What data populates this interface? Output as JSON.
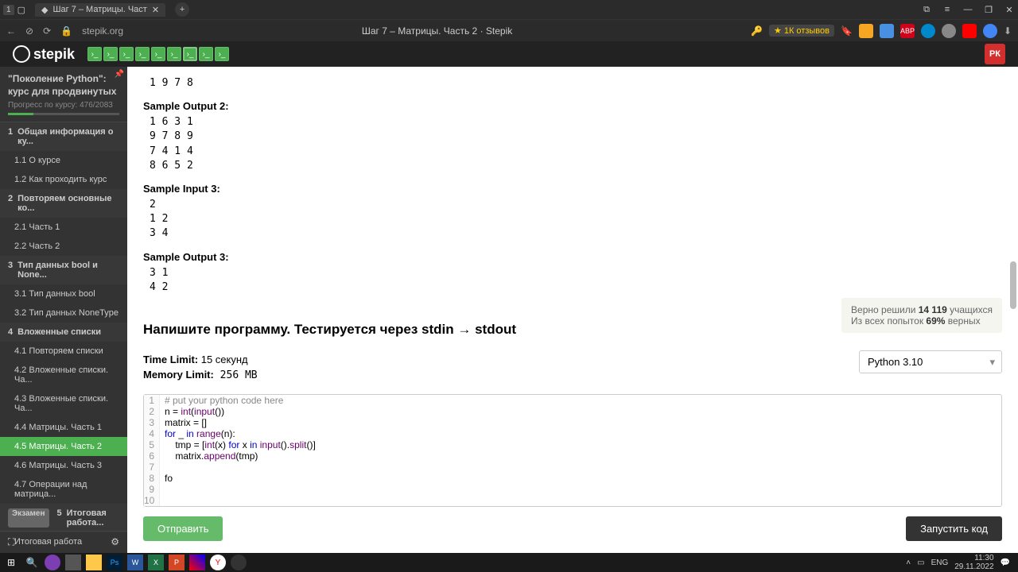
{
  "titlebar": {
    "tab_count": "1",
    "tab_title": "Шаг 7 – Матрицы. Част",
    "close": "✕",
    "plus": "+"
  },
  "address": {
    "url": "stepik.org",
    "page_title": "Шаг 7 – Матрицы. Часть 2 · Stepik",
    "reviews": "★ 1К отзывов"
  },
  "header": {
    "logo": "stepik",
    "user": "РК"
  },
  "sidebar": {
    "course_title": "\"Поколение Python\": курс для продвинутых",
    "progress": "Прогресс по курсу:  476/2083",
    "sections": [
      {
        "num": "1",
        "title": "Общая информация о ку...",
        "items": [
          {
            "id": "1.1",
            "label": "О курсе"
          },
          {
            "id": "1.2",
            "label": "Как проходить курс"
          }
        ]
      },
      {
        "num": "2",
        "title": "Повторяем основные ко...",
        "items": [
          {
            "id": "2.1",
            "label": "Часть 1"
          },
          {
            "id": "2.2",
            "label": "Часть 2"
          }
        ]
      },
      {
        "num": "3",
        "title": "Тип данных bool и None...",
        "items": [
          {
            "id": "3.1",
            "label": "Тип данных bool"
          },
          {
            "id": "3.2",
            "label": "Тип данных NoneType"
          }
        ]
      },
      {
        "num": "4",
        "title": "Вложенные списки",
        "items": [
          {
            "id": "4.1",
            "label": "Повторяем списки"
          },
          {
            "id": "4.2",
            "label": "Вложенные списки. Ча..."
          },
          {
            "id": "4.3",
            "label": "Вложенные списки. Ча..."
          },
          {
            "id": "4.4",
            "label": "Матрицы. Часть 1"
          },
          {
            "id": "4.5",
            "label": "Матрицы. Часть 2",
            "active": true
          },
          {
            "id": "4.6",
            "label": "Матрицы. Часть 3"
          },
          {
            "id": "4.7",
            "label": "Операции над матрица..."
          }
        ]
      },
      {
        "num": "5",
        "title": "Итоговая работа...",
        "exam": "Экзамен",
        "items": [
          {
            "id": "",
            "label": "Итоговая работа"
          }
        ]
      }
    ]
  },
  "content": {
    "samples": [
      {
        "label": "",
        "code": "1 9 7 8"
      },
      {
        "label": "Sample Output 2:",
        "code": "1 6 3 1\n9 7 8 9\n7 4 1 4\n8 6 5 2"
      },
      {
        "label": "Sample Input 3:",
        "code": "2\n1 2\n3 4"
      },
      {
        "label": "Sample Output 3:",
        "code": "3 1\n4 2"
      }
    ],
    "stats_line1_a": "Верно решили ",
    "stats_line1_b": "14 119",
    "stats_line1_c": " учащихся",
    "stats_line2_a": "Из всех попыток ",
    "stats_line2_b": "69%",
    "stats_line2_c": " верных",
    "task_title": "Напишите программу. Тестируется через stdin → stdout",
    "time_limit_label": "Time Limit:",
    "time_limit_value": " 15 секунд",
    "mem_limit_label": "Memory Limit:",
    "mem_limit_value": " 256 MB",
    "language": "Python 3.10",
    "code_lines": [
      "# put your python code here",
      "n = int(input())",
      "matrix = []",
      "for _ in range(n):",
      "    tmp = [int(x) for x in input().split()]",
      "    matrix.append(tmp)",
      "",
      "fo",
      "",
      ""
    ],
    "submit": "Отправить",
    "run": "Запустить код"
  },
  "taskbar": {
    "lang": "ENG",
    "time": "11:30",
    "date": "29.11.2022"
  }
}
